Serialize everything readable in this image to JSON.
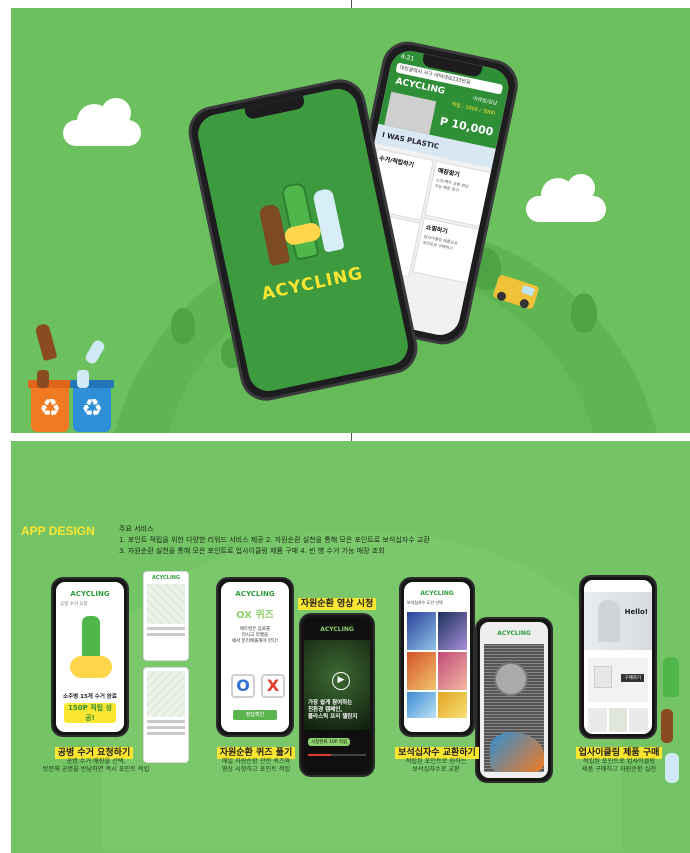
{
  "hero": {
    "app_name": "ACYCLING",
    "phone2": {
      "time": "4:21",
      "address": "대전광역시 서구 대덕대로233번길",
      "location_btn": "위치설정",
      "brand": "ACYCLING",
      "user": "아큐멍/강남",
      "accum_label": "적립 : 1000 / 3000",
      "points": "P 10,000",
      "banner_text": "I WAS PLASTIC",
      "menu": [
        {
          "title": "수거/적립하기",
          "desc": ""
        },
        {
          "title": "매장찾기",
          "desc": "소주/맥주 공병 반납\n가능 매장 찾기"
        },
        {
          "title": "",
          "desc": ""
        },
        {
          "title": "쇼핑하기",
          "desc": "업사이클링 제품으로\n포인트로 구매하기"
        }
      ]
    }
  },
  "section2": {
    "heading": "APP DESIGN",
    "services_title": "주요 서비스",
    "services": [
      "1. 포인트 적립을 위한 다양한 리워드 서비스 제공   2. 자원순환 실천을 통해 모은 포인트로 보석십자수 교환",
      "3. 자원순환 실천을 통해 모은 포인트로 업사이클링 제품 구매   4. 빈 병 수거 가능 매장 조회"
    ],
    "features": [
      {
        "title": "공병 수거 요청하기",
        "desc": "공병 수거 매장을 선택,\n방문해 공병을 반납하면 즉시 포인트 적립"
      },
      {
        "title": "자원순환 퀴즈 풀기",
        "desc": "매일 자원순환 관련 퀴즈와\n영상 시청하고 포인트 적립"
      },
      {
        "title": "자원순환 영상 시청",
        "desc": ""
      },
      {
        "title": "보석십자수 교환하기",
        "desc": "적립된 포인트로 원하는\n보석십자수로 교환"
      },
      {
        "title": "업사이클링 제품 구매",
        "desc": "적립된 포인트로 업사이클링\n제품 구매하고 자원순환 실천"
      }
    ],
    "screen1": {
      "brand": "ACYCLING",
      "sub": "공병 수거 요청",
      "success_line": "소주병 15개 수거 완료",
      "success_badge": "150P 적립 성공!"
    },
    "quiz": {
      "brand": "ACYCLING",
      "title": "OX 퀴즈",
      "question": "페트병은 음료를\n마시고 라벨을\n떼서 분리배출해야 한다!",
      "o": "O",
      "x": "X",
      "btn": "정답확인"
    },
    "video": {
      "brand": "ACYCLING",
      "caption": "가장 쉽게 참여하는\n친환경 캠페인,\n플라스틱 프리 챌린지",
      "pill": "시청완료 10P 적립"
    },
    "gems": {
      "brand": "ACYCLING",
      "sub": "보석십자수 도안 선택"
    },
    "shop": {
      "hello": "Hello!",
      "btn": "구매하기"
    }
  },
  "colors": {
    "green": "#6cc15e",
    "dark_green": "#2f8f37",
    "yellow": "#fbe632",
    "orange": "#f07a22",
    "blue": "#2f8fd6"
  }
}
